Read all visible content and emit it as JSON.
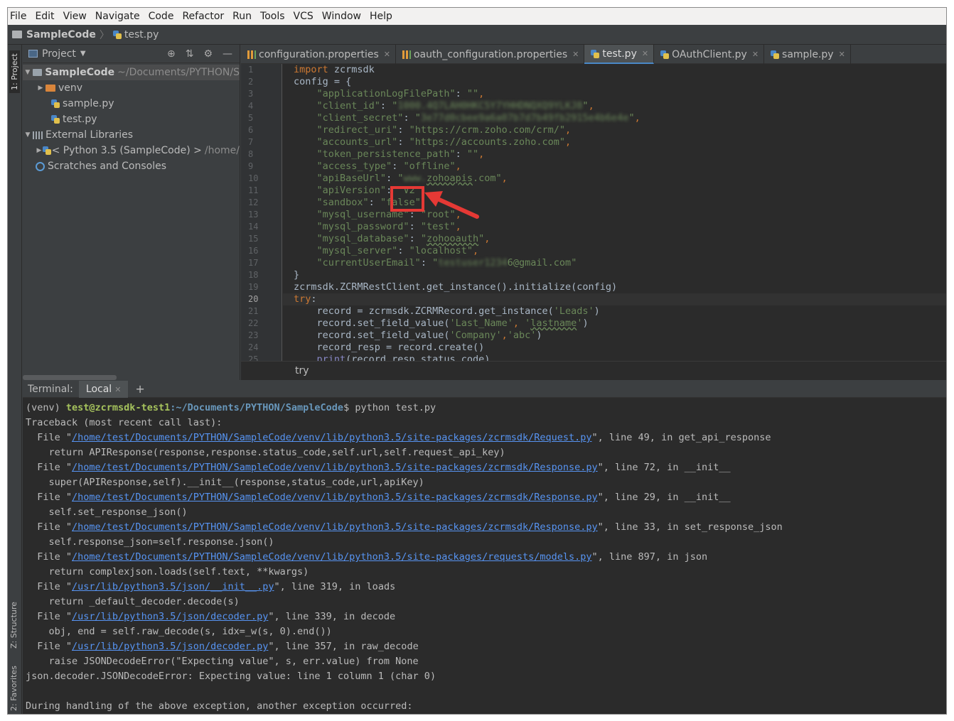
{
  "menu": [
    "File",
    "Edit",
    "View",
    "Navigate",
    "Code",
    "Refactor",
    "Run",
    "Tools",
    "VCS",
    "Window",
    "Help"
  ],
  "breadcrumb": {
    "project": "SampleCode",
    "file": "test.py"
  },
  "stripe": {
    "project": "1: Project",
    "structure": "Z: Structure",
    "favorites": "2: Favorites"
  },
  "project_panel": {
    "title": "Project",
    "tree": [
      {
        "label": "SampleCode",
        "hint": "~/Documents/PYTHON/S"
      },
      {
        "label": "venv"
      },
      {
        "label": "sample.py"
      },
      {
        "label": "test.py"
      },
      {
        "label": "External Libraries"
      },
      {
        "label": "< Python 3.5 (SampleCode) >",
        "hint": "/home/"
      },
      {
        "label": "Scratches and Consoles"
      }
    ]
  },
  "tabs": [
    "configuration.properties",
    "oauth_configuration.properties",
    "test.py",
    "OAuthClient.py",
    "sample.py"
  ],
  "code": {
    "client_id_blurred": "1000.4Q7LAH0HKC5Y7YHHDNQXQ9YLKJ8",
    "client_secret_blurred": "3e77d0cbee9a6a07b7d7b49fb2915e4b6e4e",
    "email_blurred": "testuser1234",
    "email_suffix": "6@gmail.com",
    "api_base_blurred": "www."
  },
  "editor_breadcrumb": "try",
  "terminal": {
    "label": "Terminal:",
    "tab": "Local",
    "venv": "(venv) ",
    "user": "test@zcrmsdk-test1",
    "path": ":~/Documents/PYTHON/SampleCode",
    "command": "$ python test.py"
  },
  "colors": {
    "accent": "#4a88c7",
    "annotation": "#e53935",
    "link": "#5794f2"
  }
}
